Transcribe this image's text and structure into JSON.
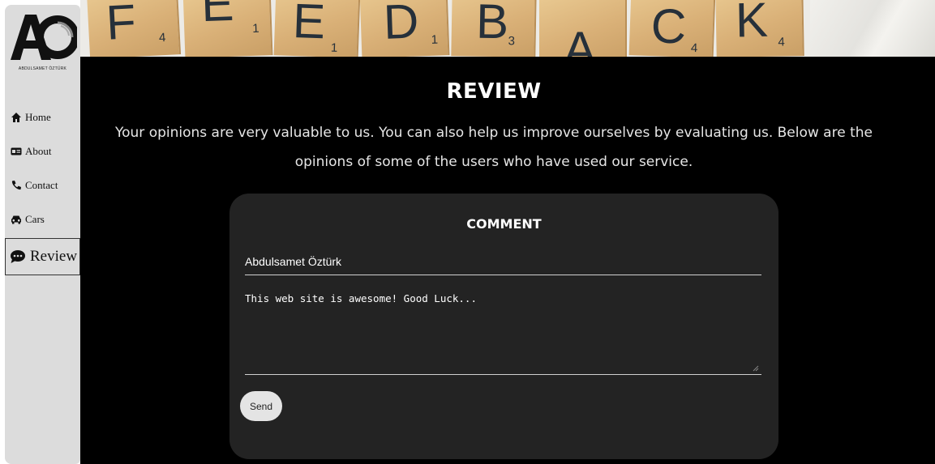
{
  "logo": {
    "monogram": "AO",
    "caption": "ABDULSAMET ÖZTÜRK"
  },
  "nav": {
    "items": [
      {
        "label": "Home",
        "icon": "home-icon"
      },
      {
        "label": "About",
        "icon": "id-card-icon"
      },
      {
        "label": "Contact",
        "icon": "phone-icon"
      },
      {
        "label": "Cars",
        "icon": "car-icon"
      },
      {
        "label": "Review",
        "icon": "comment-icon",
        "active": true
      }
    ]
  },
  "banner": {
    "tiles": [
      {
        "letter": "F",
        "score": "4"
      },
      {
        "letter": "E",
        "score": "1"
      },
      {
        "letter": "E",
        "score": "1"
      },
      {
        "letter": "D",
        "score": "1"
      },
      {
        "letter": "B",
        "score": "3"
      },
      {
        "letter": "A",
        "score": ""
      },
      {
        "letter": "C",
        "score": "4"
      },
      {
        "letter": "K",
        "score": "4"
      }
    ]
  },
  "main": {
    "title": "REVIEW",
    "intro": "Your opinions are very valuable to us. You can also help us improve ourselves by evaluating us. Below are the opinions of some of the users who have used our service."
  },
  "comment_form": {
    "title": "COMMENT",
    "name_value": "Abdulsamet Öztürk",
    "comment_value": "This web site is awesome! Good Luck...",
    "send_label": "Send"
  },
  "colors": {
    "sidebar_bg": "#dcdcdc",
    "main_bg": "#000000",
    "card_bg": "#232323",
    "button_bg": "#e4e4e4"
  }
}
